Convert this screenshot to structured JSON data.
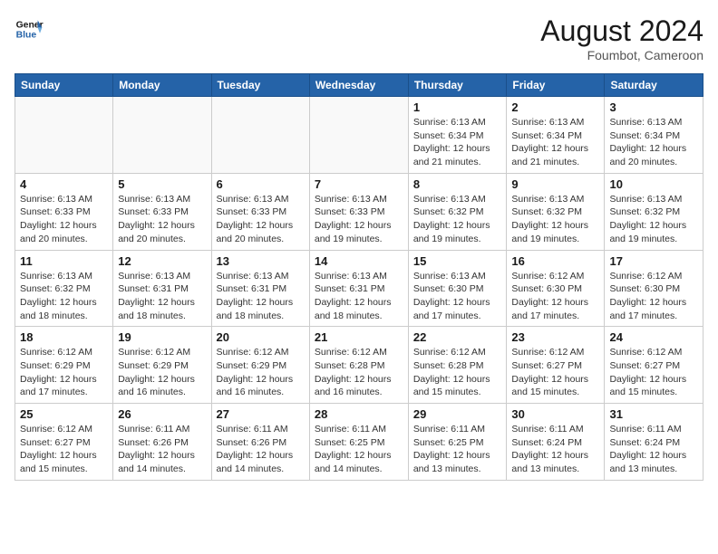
{
  "header": {
    "logo_line1": "General",
    "logo_line2": "Blue",
    "month_year": "August 2024",
    "location": "Foumbot, Cameroon"
  },
  "days_of_week": [
    "Sunday",
    "Monday",
    "Tuesday",
    "Wednesday",
    "Thursday",
    "Friday",
    "Saturday"
  ],
  "weeks": [
    [
      {
        "day": "",
        "info": ""
      },
      {
        "day": "",
        "info": ""
      },
      {
        "day": "",
        "info": ""
      },
      {
        "day": "",
        "info": ""
      },
      {
        "day": "1",
        "info": "Sunrise: 6:13 AM\nSunset: 6:34 PM\nDaylight: 12 hours\nand 21 minutes."
      },
      {
        "day": "2",
        "info": "Sunrise: 6:13 AM\nSunset: 6:34 PM\nDaylight: 12 hours\nand 21 minutes."
      },
      {
        "day": "3",
        "info": "Sunrise: 6:13 AM\nSunset: 6:34 PM\nDaylight: 12 hours\nand 20 minutes."
      }
    ],
    [
      {
        "day": "4",
        "info": "Sunrise: 6:13 AM\nSunset: 6:33 PM\nDaylight: 12 hours\nand 20 minutes."
      },
      {
        "day": "5",
        "info": "Sunrise: 6:13 AM\nSunset: 6:33 PM\nDaylight: 12 hours\nand 20 minutes."
      },
      {
        "day": "6",
        "info": "Sunrise: 6:13 AM\nSunset: 6:33 PM\nDaylight: 12 hours\nand 20 minutes."
      },
      {
        "day": "7",
        "info": "Sunrise: 6:13 AM\nSunset: 6:33 PM\nDaylight: 12 hours\nand 19 minutes."
      },
      {
        "day": "8",
        "info": "Sunrise: 6:13 AM\nSunset: 6:32 PM\nDaylight: 12 hours\nand 19 minutes."
      },
      {
        "day": "9",
        "info": "Sunrise: 6:13 AM\nSunset: 6:32 PM\nDaylight: 12 hours\nand 19 minutes."
      },
      {
        "day": "10",
        "info": "Sunrise: 6:13 AM\nSunset: 6:32 PM\nDaylight: 12 hours\nand 19 minutes."
      }
    ],
    [
      {
        "day": "11",
        "info": "Sunrise: 6:13 AM\nSunset: 6:32 PM\nDaylight: 12 hours\nand 18 minutes."
      },
      {
        "day": "12",
        "info": "Sunrise: 6:13 AM\nSunset: 6:31 PM\nDaylight: 12 hours\nand 18 minutes."
      },
      {
        "day": "13",
        "info": "Sunrise: 6:13 AM\nSunset: 6:31 PM\nDaylight: 12 hours\nand 18 minutes."
      },
      {
        "day": "14",
        "info": "Sunrise: 6:13 AM\nSunset: 6:31 PM\nDaylight: 12 hours\nand 18 minutes."
      },
      {
        "day": "15",
        "info": "Sunrise: 6:13 AM\nSunset: 6:30 PM\nDaylight: 12 hours\nand 17 minutes."
      },
      {
        "day": "16",
        "info": "Sunrise: 6:12 AM\nSunset: 6:30 PM\nDaylight: 12 hours\nand 17 minutes."
      },
      {
        "day": "17",
        "info": "Sunrise: 6:12 AM\nSunset: 6:30 PM\nDaylight: 12 hours\nand 17 minutes."
      }
    ],
    [
      {
        "day": "18",
        "info": "Sunrise: 6:12 AM\nSunset: 6:29 PM\nDaylight: 12 hours\nand 17 minutes."
      },
      {
        "day": "19",
        "info": "Sunrise: 6:12 AM\nSunset: 6:29 PM\nDaylight: 12 hours\nand 16 minutes."
      },
      {
        "day": "20",
        "info": "Sunrise: 6:12 AM\nSunset: 6:29 PM\nDaylight: 12 hours\nand 16 minutes."
      },
      {
        "day": "21",
        "info": "Sunrise: 6:12 AM\nSunset: 6:28 PM\nDaylight: 12 hours\nand 16 minutes."
      },
      {
        "day": "22",
        "info": "Sunrise: 6:12 AM\nSunset: 6:28 PM\nDaylight: 12 hours\nand 15 minutes."
      },
      {
        "day": "23",
        "info": "Sunrise: 6:12 AM\nSunset: 6:27 PM\nDaylight: 12 hours\nand 15 minutes."
      },
      {
        "day": "24",
        "info": "Sunrise: 6:12 AM\nSunset: 6:27 PM\nDaylight: 12 hours\nand 15 minutes."
      }
    ],
    [
      {
        "day": "25",
        "info": "Sunrise: 6:12 AM\nSunset: 6:27 PM\nDaylight: 12 hours\nand 15 minutes."
      },
      {
        "day": "26",
        "info": "Sunrise: 6:11 AM\nSunset: 6:26 PM\nDaylight: 12 hours\nand 14 minutes."
      },
      {
        "day": "27",
        "info": "Sunrise: 6:11 AM\nSunset: 6:26 PM\nDaylight: 12 hours\nand 14 minutes."
      },
      {
        "day": "28",
        "info": "Sunrise: 6:11 AM\nSunset: 6:25 PM\nDaylight: 12 hours\nand 14 minutes."
      },
      {
        "day": "29",
        "info": "Sunrise: 6:11 AM\nSunset: 6:25 PM\nDaylight: 12 hours\nand 13 minutes."
      },
      {
        "day": "30",
        "info": "Sunrise: 6:11 AM\nSunset: 6:24 PM\nDaylight: 12 hours\nand 13 minutes."
      },
      {
        "day": "31",
        "info": "Sunrise: 6:11 AM\nSunset: 6:24 PM\nDaylight: 12 hours\nand 13 minutes."
      }
    ]
  ]
}
